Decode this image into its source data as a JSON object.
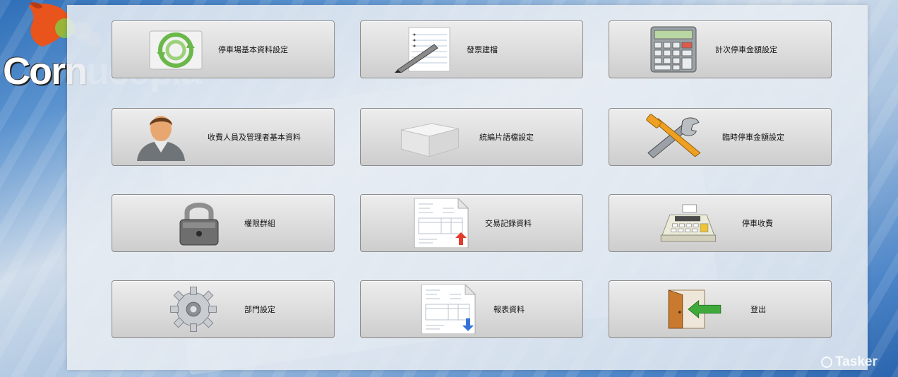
{
  "app": {
    "logo_text_main": "Corn",
    "logo_text_faded": "ucopia",
    "watermark": "Tasker"
  },
  "colors": {
    "accent_green": "#3fa93c",
    "accent_red": "#e33b2c",
    "accent_blue": "#3572d8",
    "tool_orange": "#f0a020"
  },
  "menu": {
    "tiles": [
      {
        "label": "停車場基本資料設定",
        "icon": "recycle-arrows-icon"
      },
      {
        "label": "發票建檔",
        "icon": "notepad-pen-icon"
      },
      {
        "label": "計次停車金額設定",
        "icon": "calculator-icon"
      },
      {
        "label": "收費人員及管理者基本資料",
        "icon": "user-avatar-icon"
      },
      {
        "label": "統編片語檔設定",
        "icon": "box-icon"
      },
      {
        "label": "臨時停車金額設定",
        "icon": "tools-icon"
      },
      {
        "label": "權限群組",
        "icon": "padlock-icon"
      },
      {
        "label": "交易記錄資料",
        "icon": "invoice-up-icon"
      },
      {
        "label": "停車收費",
        "icon": "cash-register-icon"
      },
      {
        "label": "部門設定",
        "icon": "gear-icon"
      },
      {
        "label": "報表資料",
        "icon": "invoice-down-icon"
      },
      {
        "label": "登出",
        "icon": "exit-door-icon"
      }
    ]
  }
}
